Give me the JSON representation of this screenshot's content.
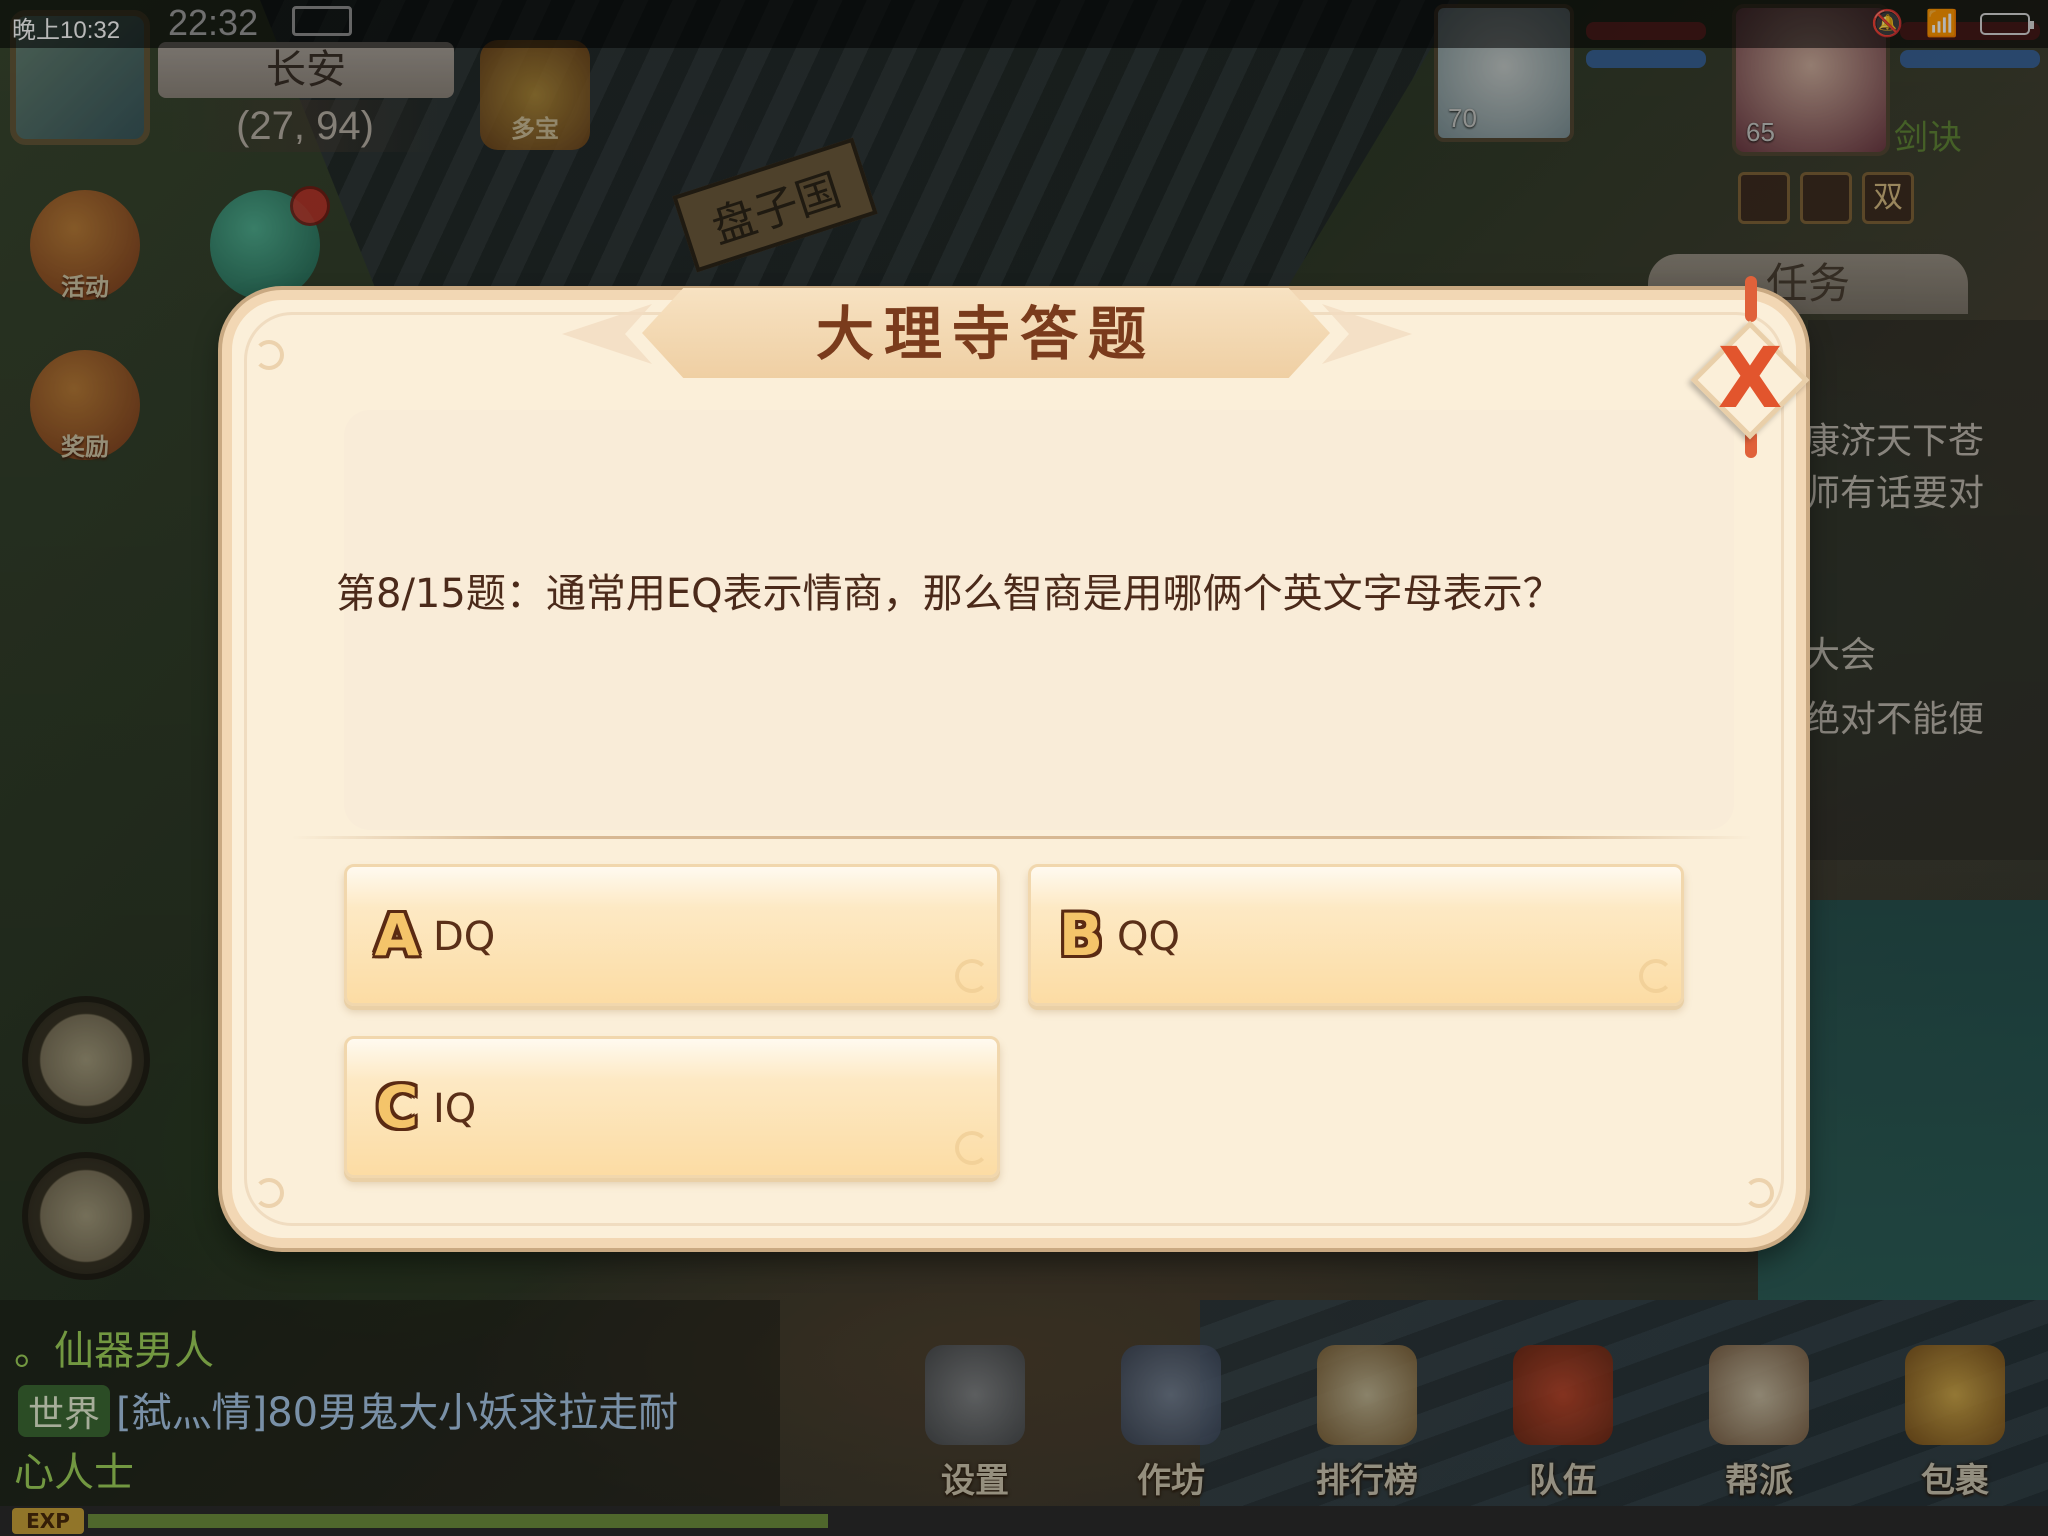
{
  "status_bar": {
    "time": "晚上10:32",
    "server_time": "22:32"
  },
  "location": {
    "name": "长安",
    "coords": "(27, 94)"
  },
  "top_buttons": {
    "treasure_label": "多宝"
  },
  "side_buttons": [
    {
      "label": "活动"
    },
    {
      "label": "奖励"
    }
  ],
  "scene_sign": "盘子国",
  "pet": {
    "level": "70"
  },
  "player": {
    "level": "65",
    "name_fragment": "剑诀"
  },
  "buffs": [
    "",
    "",
    "双"
  ],
  "task_panel": {
    "tab_label": "任务",
    "lines": [
      "康济天下苍",
      "师有话要对",
      "大会",
      "绝对不能便"
    ]
  },
  "dialog": {
    "title": "大理寺答题",
    "question": "第8/15题：通常用EQ表示情商，那么智商是用哪俩个英文字母表示？",
    "options": [
      {
        "letter": "A",
        "text": "DQ"
      },
      {
        "letter": "B",
        "text": "QQ"
      },
      {
        "letter": "C",
        "text": "IQ"
      }
    ],
    "close_glyph": "X"
  },
  "chat": {
    "line1": "。仙器男人",
    "world_tag": "世界",
    "line2": "[弑灬情]80男鬼大小妖求拉走耐",
    "line3": "心人士"
  },
  "bottom_menu": [
    {
      "label": "设置"
    },
    {
      "label": "作坊"
    },
    {
      "label": "排行榜"
    },
    {
      "label": "队伍"
    },
    {
      "label": "帮派"
    },
    {
      "label": "包裹"
    }
  ],
  "exp_label": "EXP",
  "exp_progress": 0.38,
  "colors": {
    "dialog_bg": "#fbefd9",
    "title_text": "#7a3b1c",
    "question_text": "#4b2a1a",
    "option_gradient_bottom": "#fcdca4",
    "close_x": "#e2552d"
  }
}
